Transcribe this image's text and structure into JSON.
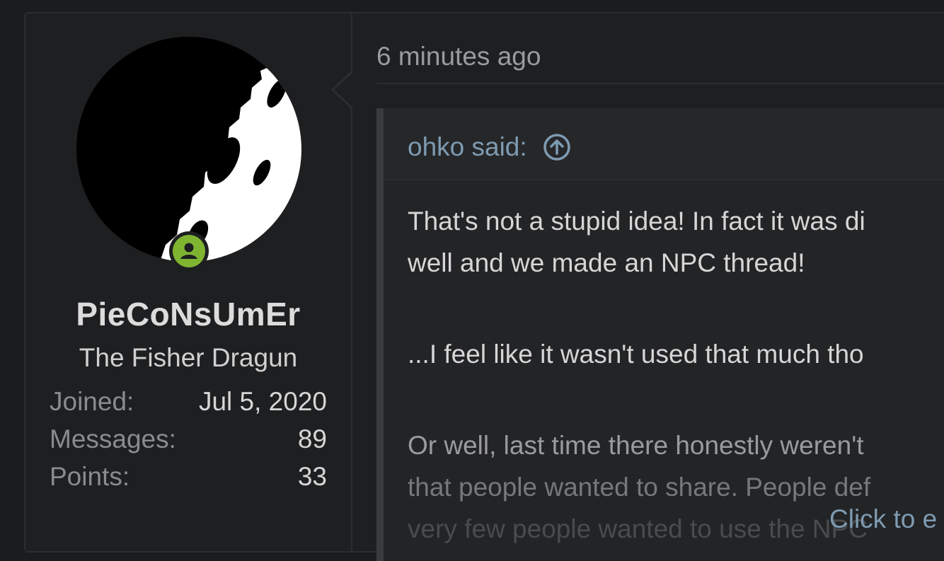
{
  "user": {
    "username": "PieCoNsUmEr",
    "title": "The Fisher Dragun",
    "stats": [
      {
        "label": "Joined:",
        "value": "Jul 5, 2020"
      },
      {
        "label": "Messages:",
        "value": "89"
      },
      {
        "label": "Points:",
        "value": "33"
      }
    ]
  },
  "post": {
    "timestamp": "6 minutes ago",
    "quote": {
      "author": "ohko said:",
      "lines": [
        "That's not a stupid idea! In fact it was di",
        "well and we made an NPC thread!",
        "...I feel like it wasn't used that much tho",
        "Or well, last time there honestly weren't",
        "that people wanted to share. People def",
        "very few people wanted to use the NPC"
      ],
      "expand_label": "Click to e"
    }
  },
  "colors": {
    "online": "#7fb431",
    "link": "#7e9bb1"
  },
  "icons": {
    "online": "user-circle-icon",
    "jump": "arrow-up-circle-icon"
  }
}
